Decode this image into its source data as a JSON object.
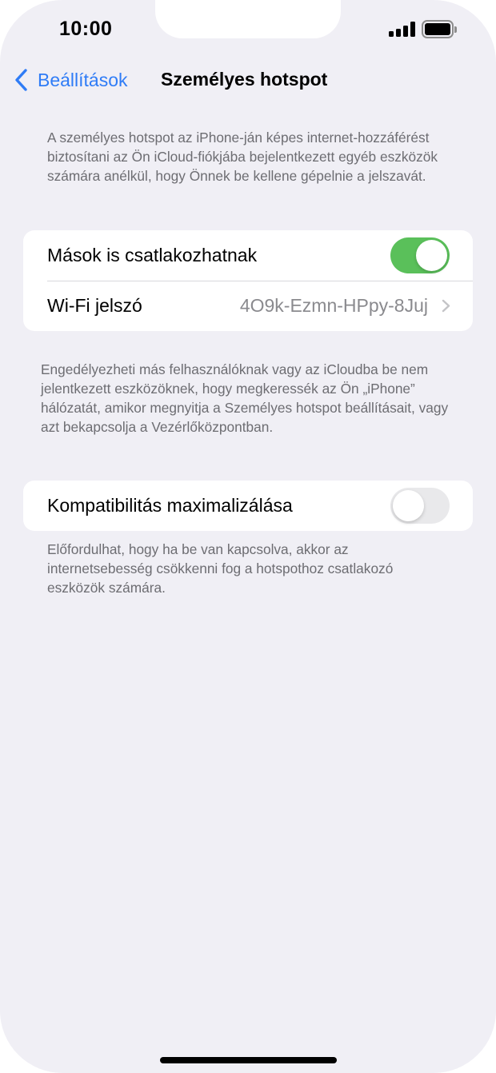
{
  "status_bar": {
    "time": "10:00"
  },
  "nav": {
    "back_label": "Beállítások",
    "title": "Személyes hotspot"
  },
  "intro_text": "A személyes hotspot az iPhone-ján képes internet-hozzáférést biztosítani az Ön iCloud-fiókjába bejelentkezett egyéb eszközök számára anélkül, hogy Önnek be kellene gépelnie a jelszavát.",
  "hotspot_group": {
    "allow_others_label": "Mások is csatlakozhatnak",
    "allow_others_enabled": true,
    "wifi_password_label": "Wi-Fi jelszó",
    "wifi_password_value": "4O9k-Ezmn-HPpy-8Juj"
  },
  "allow_others_footer": "Engedélyezheti más felhasználóknak vagy az iCloudba be nem jelentkezett eszközöknek, hogy megkeressék az Ön „iPhone” hálózatát, amikor megnyitja a Személyes hotspot beállításait, vagy azt bekapcsolja a Vezérlőközpontban.",
  "compat_group": {
    "max_compat_label": "Kompatibilitás maximalizálása",
    "max_compat_enabled": false
  },
  "compat_footer": "Előfordulhat, hogy ha be van kapcsolva, akkor az internetsebesség csökkenni fog a hotspothoz csatlakozó eszközök számára.",
  "colors": {
    "accent": "#2f7cf6",
    "toggle_on": "#5ac05a",
    "background": "#f0eff5"
  }
}
